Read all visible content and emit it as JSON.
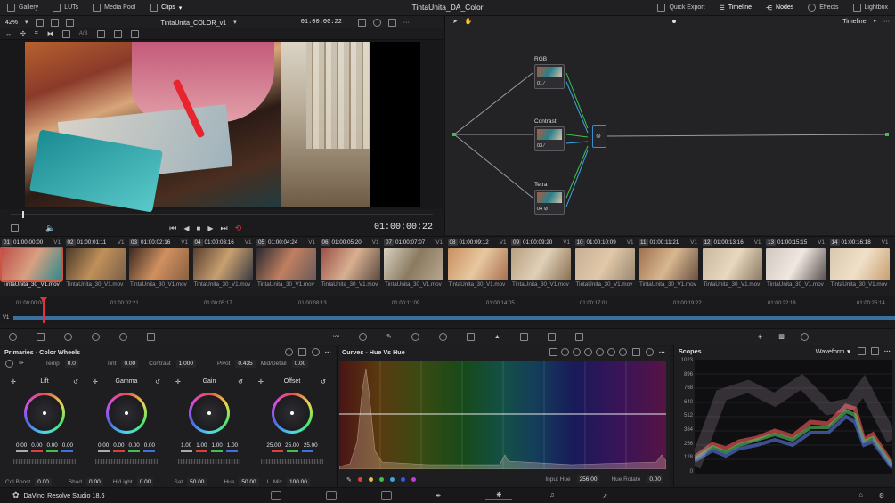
{
  "app": {
    "title": "TintaUnita_DA_Color",
    "version_label": "DaVinci Resolve Studio 18.6"
  },
  "top_left": [
    "Gallery",
    "LUTs",
    "Media Pool",
    "Clips"
  ],
  "top_right": [
    "Quick Export",
    "Timeline",
    "Nodes",
    "Effects",
    "Lightbox"
  ],
  "viewer": {
    "zoom": "42%",
    "clip_name": "TintaUnita_COLOR_v1",
    "header_timecode": "01:00:00:22",
    "timecode": "01:00:00:22",
    "ab_label": "A/B"
  },
  "nodes_panel": {
    "dropdown": "Timeline",
    "nodes": [
      {
        "label": "RGB",
        "num": "01"
      },
      {
        "label": "Contrast",
        "num": "03"
      },
      {
        "label": "Tetra",
        "num": "04"
      }
    ]
  },
  "clips": [
    {
      "num": "01",
      "tc": "01:00:00:00",
      "track": "V1",
      "name": "TintaUnita_30_V1.mov"
    },
    {
      "num": "02",
      "tc": "01:00:01:11",
      "track": "V1",
      "name": "TintaUnita_30_V1.mov"
    },
    {
      "num": "03",
      "tc": "01:00:02:16",
      "track": "V1",
      "name": "TintaUnita_30_V1.mov"
    },
    {
      "num": "04",
      "tc": "01:00:03:16",
      "track": "V1",
      "name": "TintaUnita_30_V1.mov"
    },
    {
      "num": "05",
      "tc": "01:00:04:24",
      "track": "V1",
      "name": "TintaUnita_30_V1.mov"
    },
    {
      "num": "06",
      "tc": "01:00:05:20",
      "track": "V1",
      "name": "TintaUnita_30_V1.mov"
    },
    {
      "num": "07",
      "tc": "01:00:07:07",
      "track": "V1",
      "name": "TintaUnita_30_V1.mov"
    },
    {
      "num": "08",
      "tc": "01:00:09:12",
      "track": "V1",
      "name": "TintaUnita_30_V1.mov"
    },
    {
      "num": "09",
      "tc": "01:00:09:20",
      "track": "V1",
      "name": "TintaUnita_30_V1.mov"
    },
    {
      "num": "10",
      "tc": "01:00:10:09",
      "track": "V1",
      "name": "TintaUnita_30_V1.mov"
    },
    {
      "num": "11",
      "tc": "01:00:11:21",
      "track": "V1",
      "name": "TintaUnita_30_V1.mov"
    },
    {
      "num": "12",
      "tc": "01:00:13:16",
      "track": "V1",
      "name": "TintaUnita_30_V1.mov"
    },
    {
      "num": "13",
      "tc": "01:00:15:15",
      "track": "V1",
      "name": "TintaUnita_30_V1.mov"
    },
    {
      "num": "14",
      "tc": "01:00:16:18",
      "track": "V1",
      "name": "TintaUnita_30_V1.mov"
    }
  ],
  "ruler_ticks": [
    "01:00:00:00",
    "01:00:02:21",
    "01:00:05:17",
    "01:00:08:13",
    "01:00:11:09",
    "01:00:14:05",
    "01:00:17:01",
    "01:00:19:22",
    "01:00:22:18",
    "01:00:25:14"
  ],
  "track_label": "V1",
  "primaries": {
    "title": "Primaries - Color Wheels",
    "top_params": [
      {
        "label": "Temp",
        "value": "0.0"
      },
      {
        "label": "Tint",
        "value": "0.00"
      },
      {
        "label": "Contrast",
        "value": "1.000"
      },
      {
        "label": "Pivot",
        "value": "0.435"
      },
      {
        "label": "Mid/Detail",
        "value": "0.00"
      }
    ],
    "wheels": [
      {
        "name": "Lift",
        "values": [
          "0.00",
          "0.00",
          "0.00",
          "0.00"
        ]
      },
      {
        "name": "Gamma",
        "values": [
          "0.00",
          "0.00",
          "0.00",
          "0.00"
        ]
      },
      {
        "name": "Gain",
        "values": [
          "1.00",
          "1.00",
          "1.00",
          "1.00"
        ]
      },
      {
        "name": "Offset",
        "values": [
          "25.00",
          "25.00",
          "25.00"
        ]
      }
    ],
    "bottom_params": [
      {
        "label": "Col Boost",
        "value": "0.00"
      },
      {
        "label": "Shad",
        "value": "0.00"
      },
      {
        "label": "Hi/Light",
        "value": "0.00"
      },
      {
        "label": "Sat",
        "value": "50.00"
      },
      {
        "label": "Hue",
        "value": "50.00"
      },
      {
        "label": "L. Mix",
        "value": "100.00"
      }
    ]
  },
  "curves": {
    "title": "Curves - Hue Vs Hue",
    "input_hue_label": "Input Hue",
    "input_hue_value": "256.00",
    "hue_rotate_label": "Hue Rotate",
    "hue_rotate_value": "0.00",
    "swatch_colors": [
      "#e53a3a",
      "#e5c23a",
      "#3ac24a",
      "#3aa7e5",
      "#3a58e5",
      "#c23ae5"
    ]
  },
  "scopes": {
    "title": "Scopes",
    "mode": "Waveform",
    "scale": [
      "1023",
      "896",
      "768",
      "640",
      "512",
      "384",
      "256",
      "128",
      "0"
    ]
  }
}
